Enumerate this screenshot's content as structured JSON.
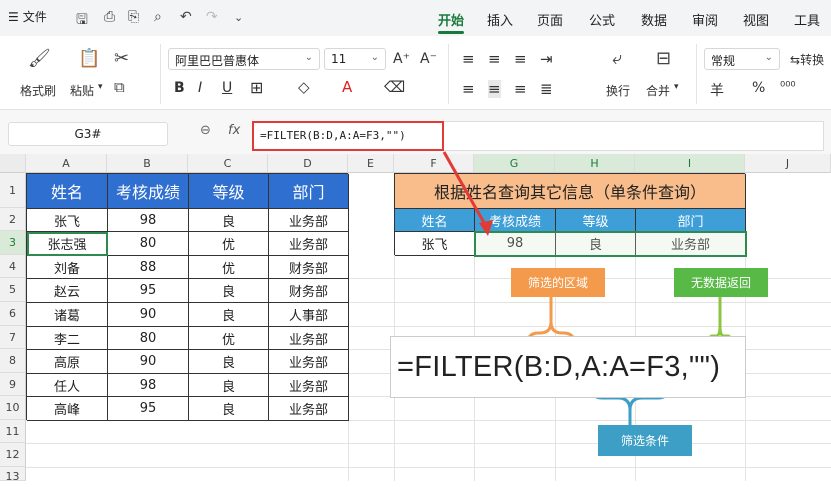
{
  "menubar": {
    "file": "文件",
    "tabs": [
      "开始",
      "插入",
      "页面",
      "公式",
      "数据",
      "审阅",
      "视图",
      "工具"
    ],
    "active_tab": "开始"
  },
  "ribbon": {
    "format_painter": "格式刷",
    "paste": "粘贴",
    "font_name": "阿里巴巴普惠体",
    "font_size": "11",
    "wrap": "换行",
    "merge": "合并",
    "number_format": "常规",
    "convert": "转换",
    "currency_symbol": "羊",
    "percent_symbol": "%"
  },
  "formula_bar": {
    "name_box": "G3#",
    "fx": "fx",
    "formula": "=FILTER(B:D,A:A=F3,\"\")"
  },
  "columns": [
    "A",
    "B",
    "C",
    "D",
    "E",
    "F",
    "G",
    "H",
    "I",
    "J"
  ],
  "rows": [
    "1",
    "2",
    "3",
    "4",
    "5",
    "6",
    "7",
    "8",
    "9",
    "10",
    "11",
    "12",
    "13"
  ],
  "source_table": {
    "headers": [
      "姓名",
      "考核成绩",
      "等级",
      "部门"
    ],
    "rows": [
      [
        "张飞",
        "98",
        "良",
        "业务部"
      ],
      [
        "张志强",
        "80",
        "优",
        "业务部"
      ],
      [
        "刘备",
        "88",
        "优",
        "财务部"
      ],
      [
        "赵云",
        "95",
        "良",
        "财务部"
      ],
      [
        "诸葛",
        "90",
        "良",
        "人事部"
      ],
      [
        "李二",
        "80",
        "优",
        "业务部"
      ],
      [
        "高原",
        "90",
        "良",
        "业务部"
      ],
      [
        "任人",
        "98",
        "良",
        "业务部"
      ],
      [
        "高峰",
        "95",
        "良",
        "业务部"
      ]
    ]
  },
  "query_table": {
    "title": "根据姓名查询其它信息（单条件查询）",
    "headers": [
      "姓名",
      "考核成绩",
      "等级",
      "部门"
    ],
    "row": [
      "张飞",
      "98",
      "良",
      "业务部"
    ]
  },
  "annotations": {
    "filter_range": "筛选的区域",
    "no_data_return": "无数据返回",
    "filter_condition": "筛选条件",
    "big_formula": "=FILTER(B:D,A:A=F3,\"\")"
  },
  "colors": {
    "accent_green": "#1a7a3c",
    "header_blue": "#2f6fd0",
    "header_teal": "#3d9ed8",
    "title_orange": "#f8bd8a",
    "note_orange": "#f39a4c",
    "note_green": "#58b947",
    "note_blue": "#3d9fc6",
    "highlight_red": "#e23a35"
  }
}
